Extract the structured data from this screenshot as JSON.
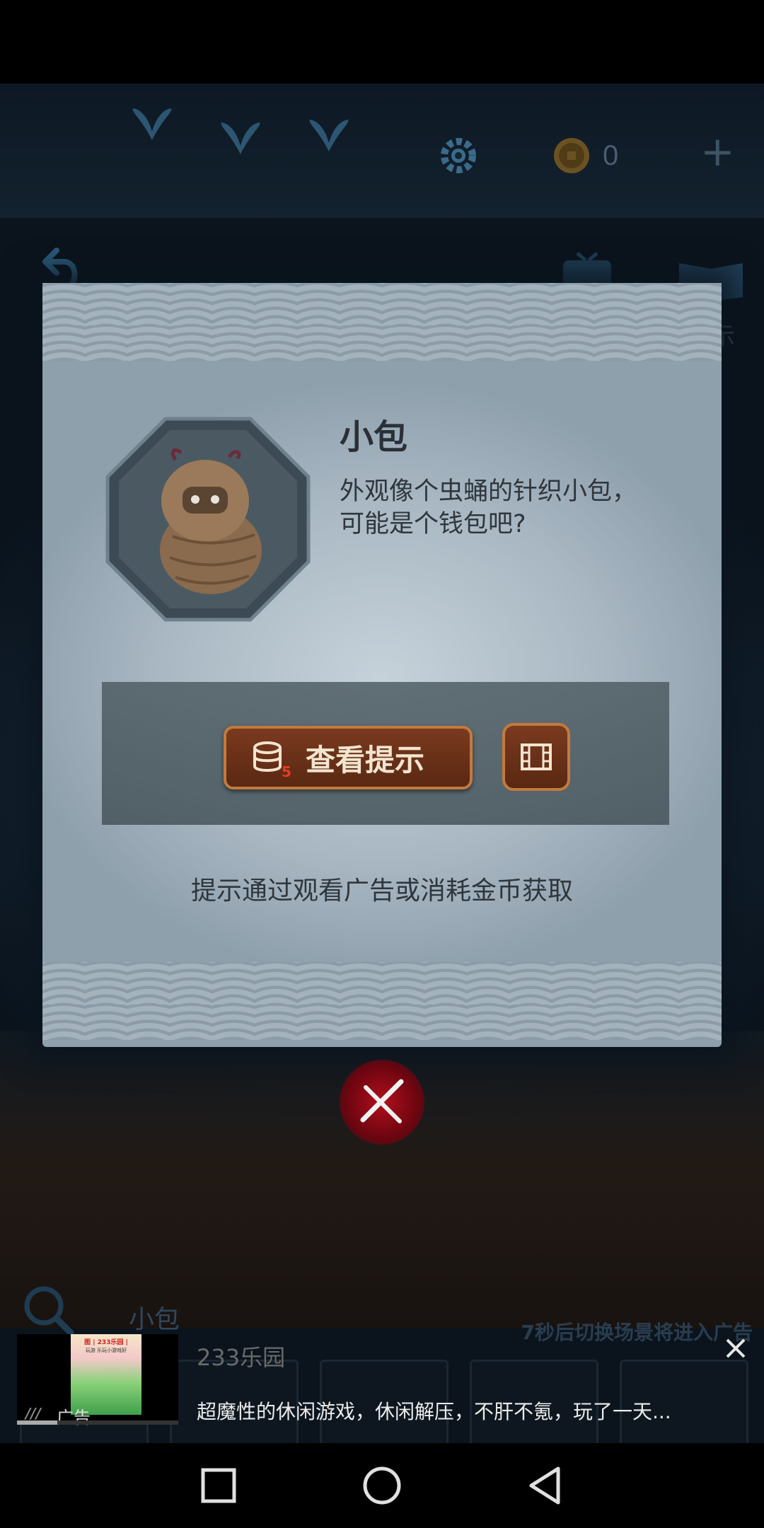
{
  "hud": {
    "coin_count": "0",
    "plus_symbol": "+",
    "edge_label": "示"
  },
  "dialog": {
    "item_name": "小包",
    "item_description": "外观像个虫蛹的针织小包，可能是个钱包吧?",
    "hint_button_label": "查看提示",
    "hint_cost": "5",
    "tip_text": "提示通过观看广告或消耗金币获取"
  },
  "bottom_hud": {
    "target_name": "小包",
    "ad_countdown": "7秒后切换场景将进入广告"
  },
  "ad": {
    "thumbnail_title": "图 | 233乐园 |",
    "thumbnail_subtitle": "玩游 乐玩小游戏好",
    "logo_text": "///",
    "tag": "广告",
    "title": "233乐园",
    "description": "超魔性的休闲游戏，休闲解压，不肝不氪，玩了一天...",
    "progress": 0.25
  },
  "colors": {
    "accent_button": "#7a3a1f",
    "button_border": "#c27a3f",
    "close_red": "#b0101c"
  },
  "icons": [
    "butterfly-icon",
    "gear-icon",
    "coin-icon",
    "plus-icon",
    "back-icon",
    "tv-icon",
    "book-icon",
    "coin-stack-icon",
    "video-icon",
    "close-icon",
    "magnifier-icon",
    "ad-close-icon",
    "square-icon",
    "circle-icon",
    "triangle-back-icon"
  ]
}
